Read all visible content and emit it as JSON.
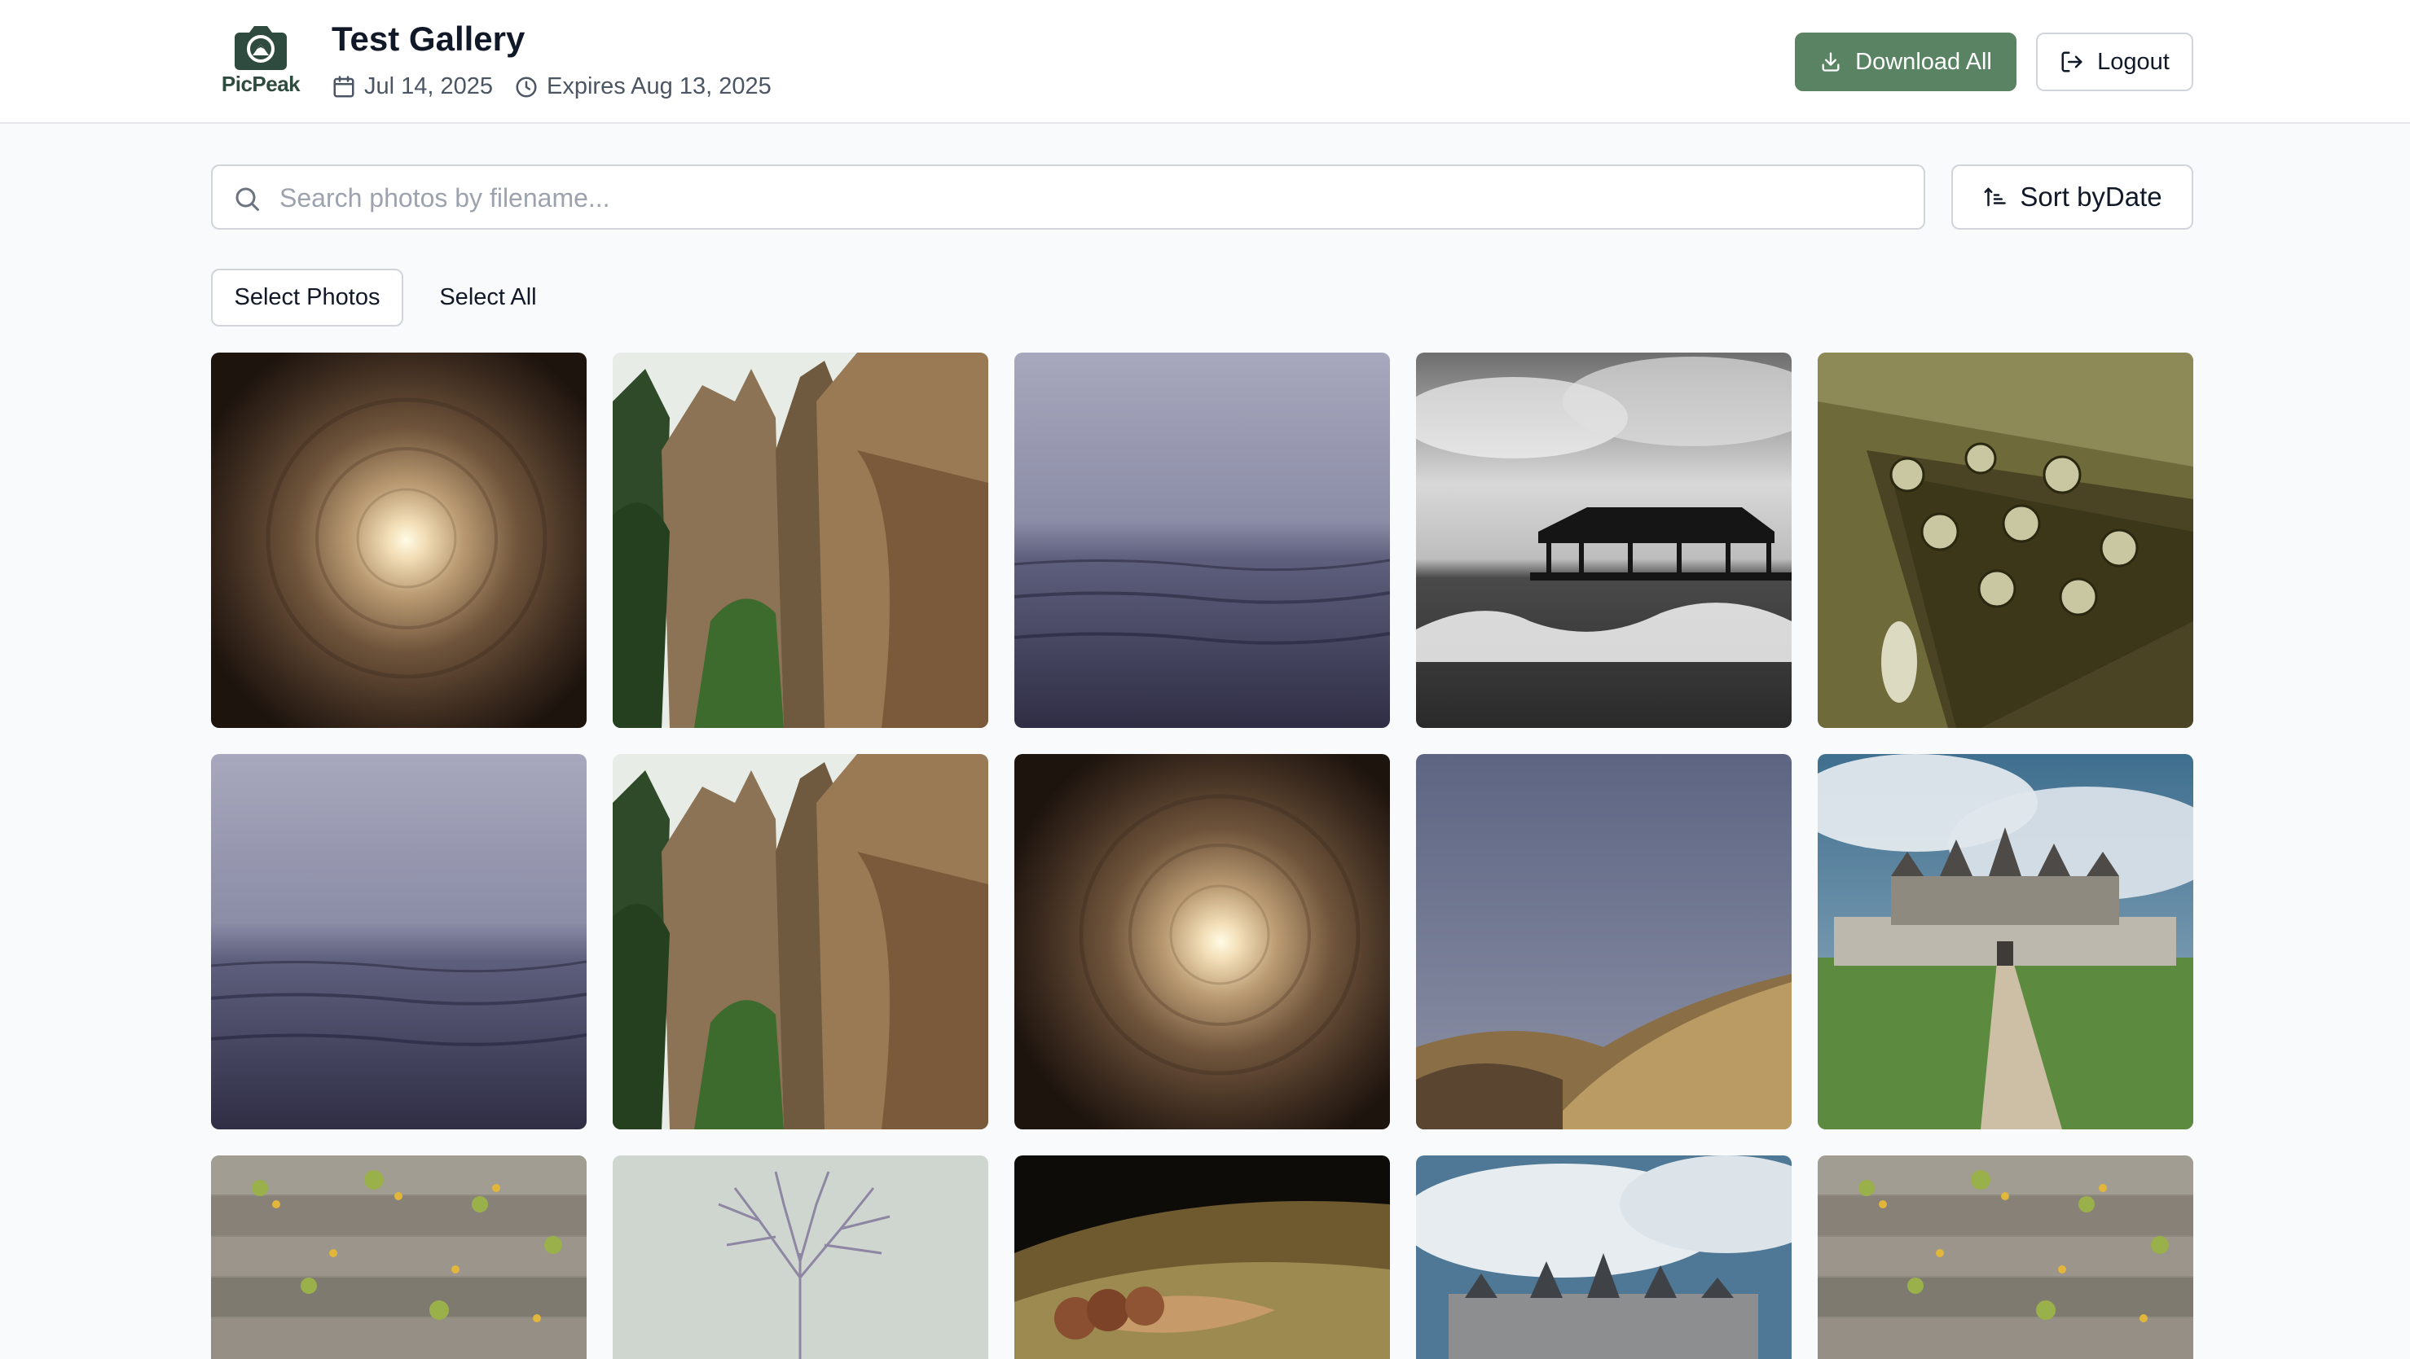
{
  "app": {
    "logo_text": "PicPeak",
    "gallery_title": "Test Gallery",
    "date": "Jul 14, 2025",
    "expires": "Expires Aug 13, 2025"
  },
  "header_actions": {
    "download_all": "Download All",
    "logout": "Logout"
  },
  "search": {
    "placeholder": "Search photos by filename...",
    "value": ""
  },
  "sort": {
    "label": "Sort byDate"
  },
  "selection": {
    "select_photos": "Select Photos",
    "select_all": "Select All"
  },
  "colors": {
    "accent": "#5a8363",
    "logo": "#2f4a3e",
    "background": "#f9fafb"
  },
  "icons": {
    "logo": "camera-mountain-icon",
    "date": "calendar-icon",
    "expires": "clock-icon",
    "download": "download-icon",
    "logout": "logout-icon",
    "search": "search-icon",
    "sort": "sort-ascending-icon"
  },
  "photos": [
    {
      "subject": "light-tunnel"
    },
    {
      "subject": "rock-cliffs"
    },
    {
      "subject": "misty-sea"
    },
    {
      "subject": "pier-bw"
    },
    {
      "subject": "guitar-headstock"
    },
    {
      "subject": "misty-sea"
    },
    {
      "subject": "rock-cliffs"
    },
    {
      "subject": "light-tunnel"
    },
    {
      "subject": "golden-hills"
    },
    {
      "subject": "chateau"
    },
    {
      "subject": "wooden-planks-flowers"
    },
    {
      "subject": "bare-tree"
    },
    {
      "subject": "pebbles-leaf"
    },
    {
      "subject": "chateau-clouds"
    },
    {
      "subject": "wooden-planks-flowers"
    }
  ]
}
